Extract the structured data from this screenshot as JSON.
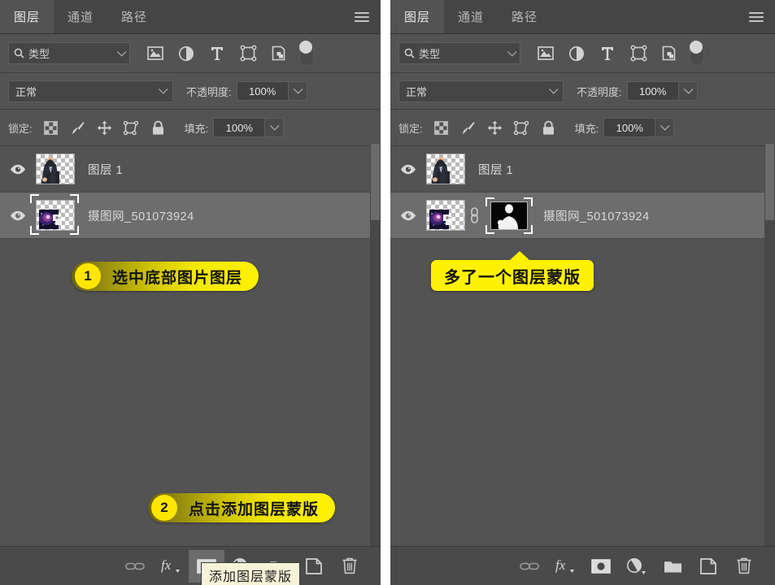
{
  "panels": [
    {
      "id": "before",
      "tabs": [
        {
          "label": "图层",
          "active": true
        },
        {
          "label": "通道",
          "active": false
        },
        {
          "label": "路径",
          "active": false
        }
      ],
      "menu_icon": "hamburger-menu-icon",
      "filter": {
        "search_icon": "search-icon",
        "kind_value": "类型",
        "dropdown_icon": "chevron-down-icon",
        "icons": [
          "pixel-layer-filter-icon",
          "adjustment-layer-filter-icon",
          "type-layer-filter-icon",
          "shape-layer-filter-icon",
          "smart-object-filter-icon"
        ],
        "toggle_icon": "filter-enable-toggle"
      },
      "blend": {
        "mode_value": "正常",
        "mode_dropdown_icon": "chevron-down-icon",
        "opacity_label": "不透明度:",
        "opacity_value": "100%",
        "opacity_spinner_icon": "chevron-down-icon"
      },
      "lock": {
        "label": "锁定:",
        "icons": [
          "lock-transparent-pixels-icon",
          "lock-image-pixels-icon",
          "lock-position-icon",
          "lock-artboard-nesting-icon",
          "lock-all-icon"
        ],
        "fill_label": "填充:",
        "fill_value": "100%",
        "fill_spinner_icon": "chevron-down-icon"
      },
      "layers": [
        {
          "name": "图层 1",
          "visible": true,
          "selected": false,
          "thumb": "person-cutout-thumbnail",
          "has_mask": false,
          "smart_object": false
        },
        {
          "name": "摄图网_501073924",
          "visible": true,
          "selected": true,
          "thumb": "galaxy-smart-object-thumbnail",
          "has_mask": false,
          "smart_object": true
        }
      ],
      "bottom_tools": [
        {
          "icon": "link-layers-icon",
          "pressed": false
        },
        {
          "icon": "layer-style-fx-icon",
          "pressed": false
        },
        {
          "icon": "add-layer-mask-icon",
          "pressed": true
        },
        {
          "icon": "new-adjustment-layer-icon",
          "pressed": false
        },
        {
          "icon": "new-group-icon",
          "pressed": false
        },
        {
          "icon": "new-layer-icon",
          "pressed": false
        },
        {
          "icon": "delete-layer-icon",
          "pressed": false
        }
      ],
      "tooltip": "添加图层蒙版",
      "callouts": [
        {
          "number": "1",
          "text": "选中底部图片图层",
          "style": "gradient"
        },
        {
          "number": "2",
          "text": "点击添加图层蒙版",
          "style": "gradient"
        }
      ]
    },
    {
      "id": "after",
      "tabs": [
        {
          "label": "图层",
          "active": true
        },
        {
          "label": "通道",
          "active": false
        },
        {
          "label": "路径",
          "active": false
        }
      ],
      "menu_icon": "hamburger-menu-icon",
      "filter": {
        "search_icon": "search-icon",
        "kind_value": "类型",
        "dropdown_icon": "chevron-down-icon",
        "icons": [
          "pixel-layer-filter-icon",
          "adjustment-layer-filter-icon",
          "type-layer-filter-icon",
          "shape-layer-filter-icon",
          "smart-object-filter-icon"
        ],
        "toggle_icon": "filter-enable-toggle"
      },
      "blend": {
        "mode_value": "正常",
        "mode_dropdown_icon": "chevron-down-icon",
        "opacity_label": "不透明度:",
        "opacity_value": "100%",
        "opacity_spinner_icon": "chevron-down-icon"
      },
      "lock": {
        "label": "锁定:",
        "icons": [
          "lock-transparent-pixels-icon",
          "lock-image-pixels-icon",
          "lock-position-icon",
          "lock-artboard-nesting-icon",
          "lock-all-icon"
        ],
        "fill_label": "填充:",
        "fill_value": "100%",
        "fill_spinner_icon": "chevron-down-icon"
      },
      "layers": [
        {
          "name": "图层 1",
          "visible": true,
          "selected": false,
          "thumb": "person-cutout-thumbnail",
          "has_mask": false,
          "smart_object": false
        },
        {
          "name": "摄图网_501073924",
          "visible": true,
          "selected": true,
          "thumb": "galaxy-smart-object-thumbnail",
          "has_mask": true,
          "mask_thumb": "person-silhouette-mask-thumbnail",
          "smart_object": true
        }
      ],
      "bottom_tools": [
        {
          "icon": "link-layers-icon",
          "pressed": false
        },
        {
          "icon": "layer-style-fx-icon",
          "pressed": false
        },
        {
          "icon": "add-layer-mask-icon",
          "pressed": false
        },
        {
          "icon": "new-adjustment-layer-icon",
          "pressed": false
        },
        {
          "icon": "new-group-icon",
          "pressed": false
        },
        {
          "icon": "new-layer-icon",
          "pressed": false
        },
        {
          "icon": "delete-layer-icon",
          "pressed": false
        }
      ],
      "callouts": [
        {
          "text": "多了一个图层蒙版",
          "style": "solid-with-arrow"
        }
      ]
    }
  ],
  "colors": {
    "panel_bg": "#535353",
    "tabbar_bg": "#454545",
    "selected_row": "#6d6d6d",
    "accent_yellow": "#fff200",
    "badge_yellow": "#ffe600",
    "tooltip_bg": "#f7f3d8",
    "text": "#d9d9d9"
  }
}
